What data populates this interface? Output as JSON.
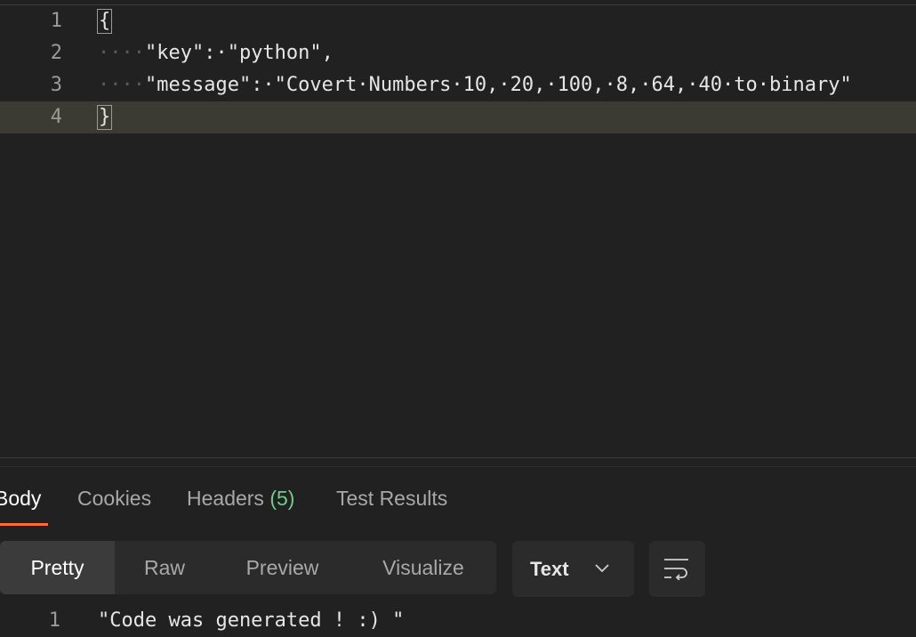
{
  "request_body": {
    "lines": [
      {
        "num": "1",
        "indent": "",
        "text": "{"
      },
      {
        "num": "2",
        "indent": "····",
        "text": "\"key\":·\"python\","
      },
      {
        "num": "3",
        "indent": "····",
        "text": "\"message\":·\"Covert·Numbers·10,·20,·100,·8,·64,·40·to·binary\""
      },
      {
        "num": "4",
        "indent": "",
        "text": "}"
      }
    ]
  },
  "response_tabs": {
    "body": "Body",
    "cookies": "Cookies",
    "headers": "Headers",
    "headers_count": "(5)",
    "test_results": "Test Results"
  },
  "view_modes": {
    "pretty": "Pretty",
    "raw": "Raw",
    "preview": "Preview",
    "visualize": "Visualize"
  },
  "format": {
    "selected": "Text"
  },
  "response_body": {
    "lines": [
      {
        "num": "1",
        "text": "\"Code was generated ! :) \""
      }
    ]
  },
  "colors": {
    "accent": "#ff6c37",
    "count": "#74c98a",
    "background": "#212121"
  }
}
